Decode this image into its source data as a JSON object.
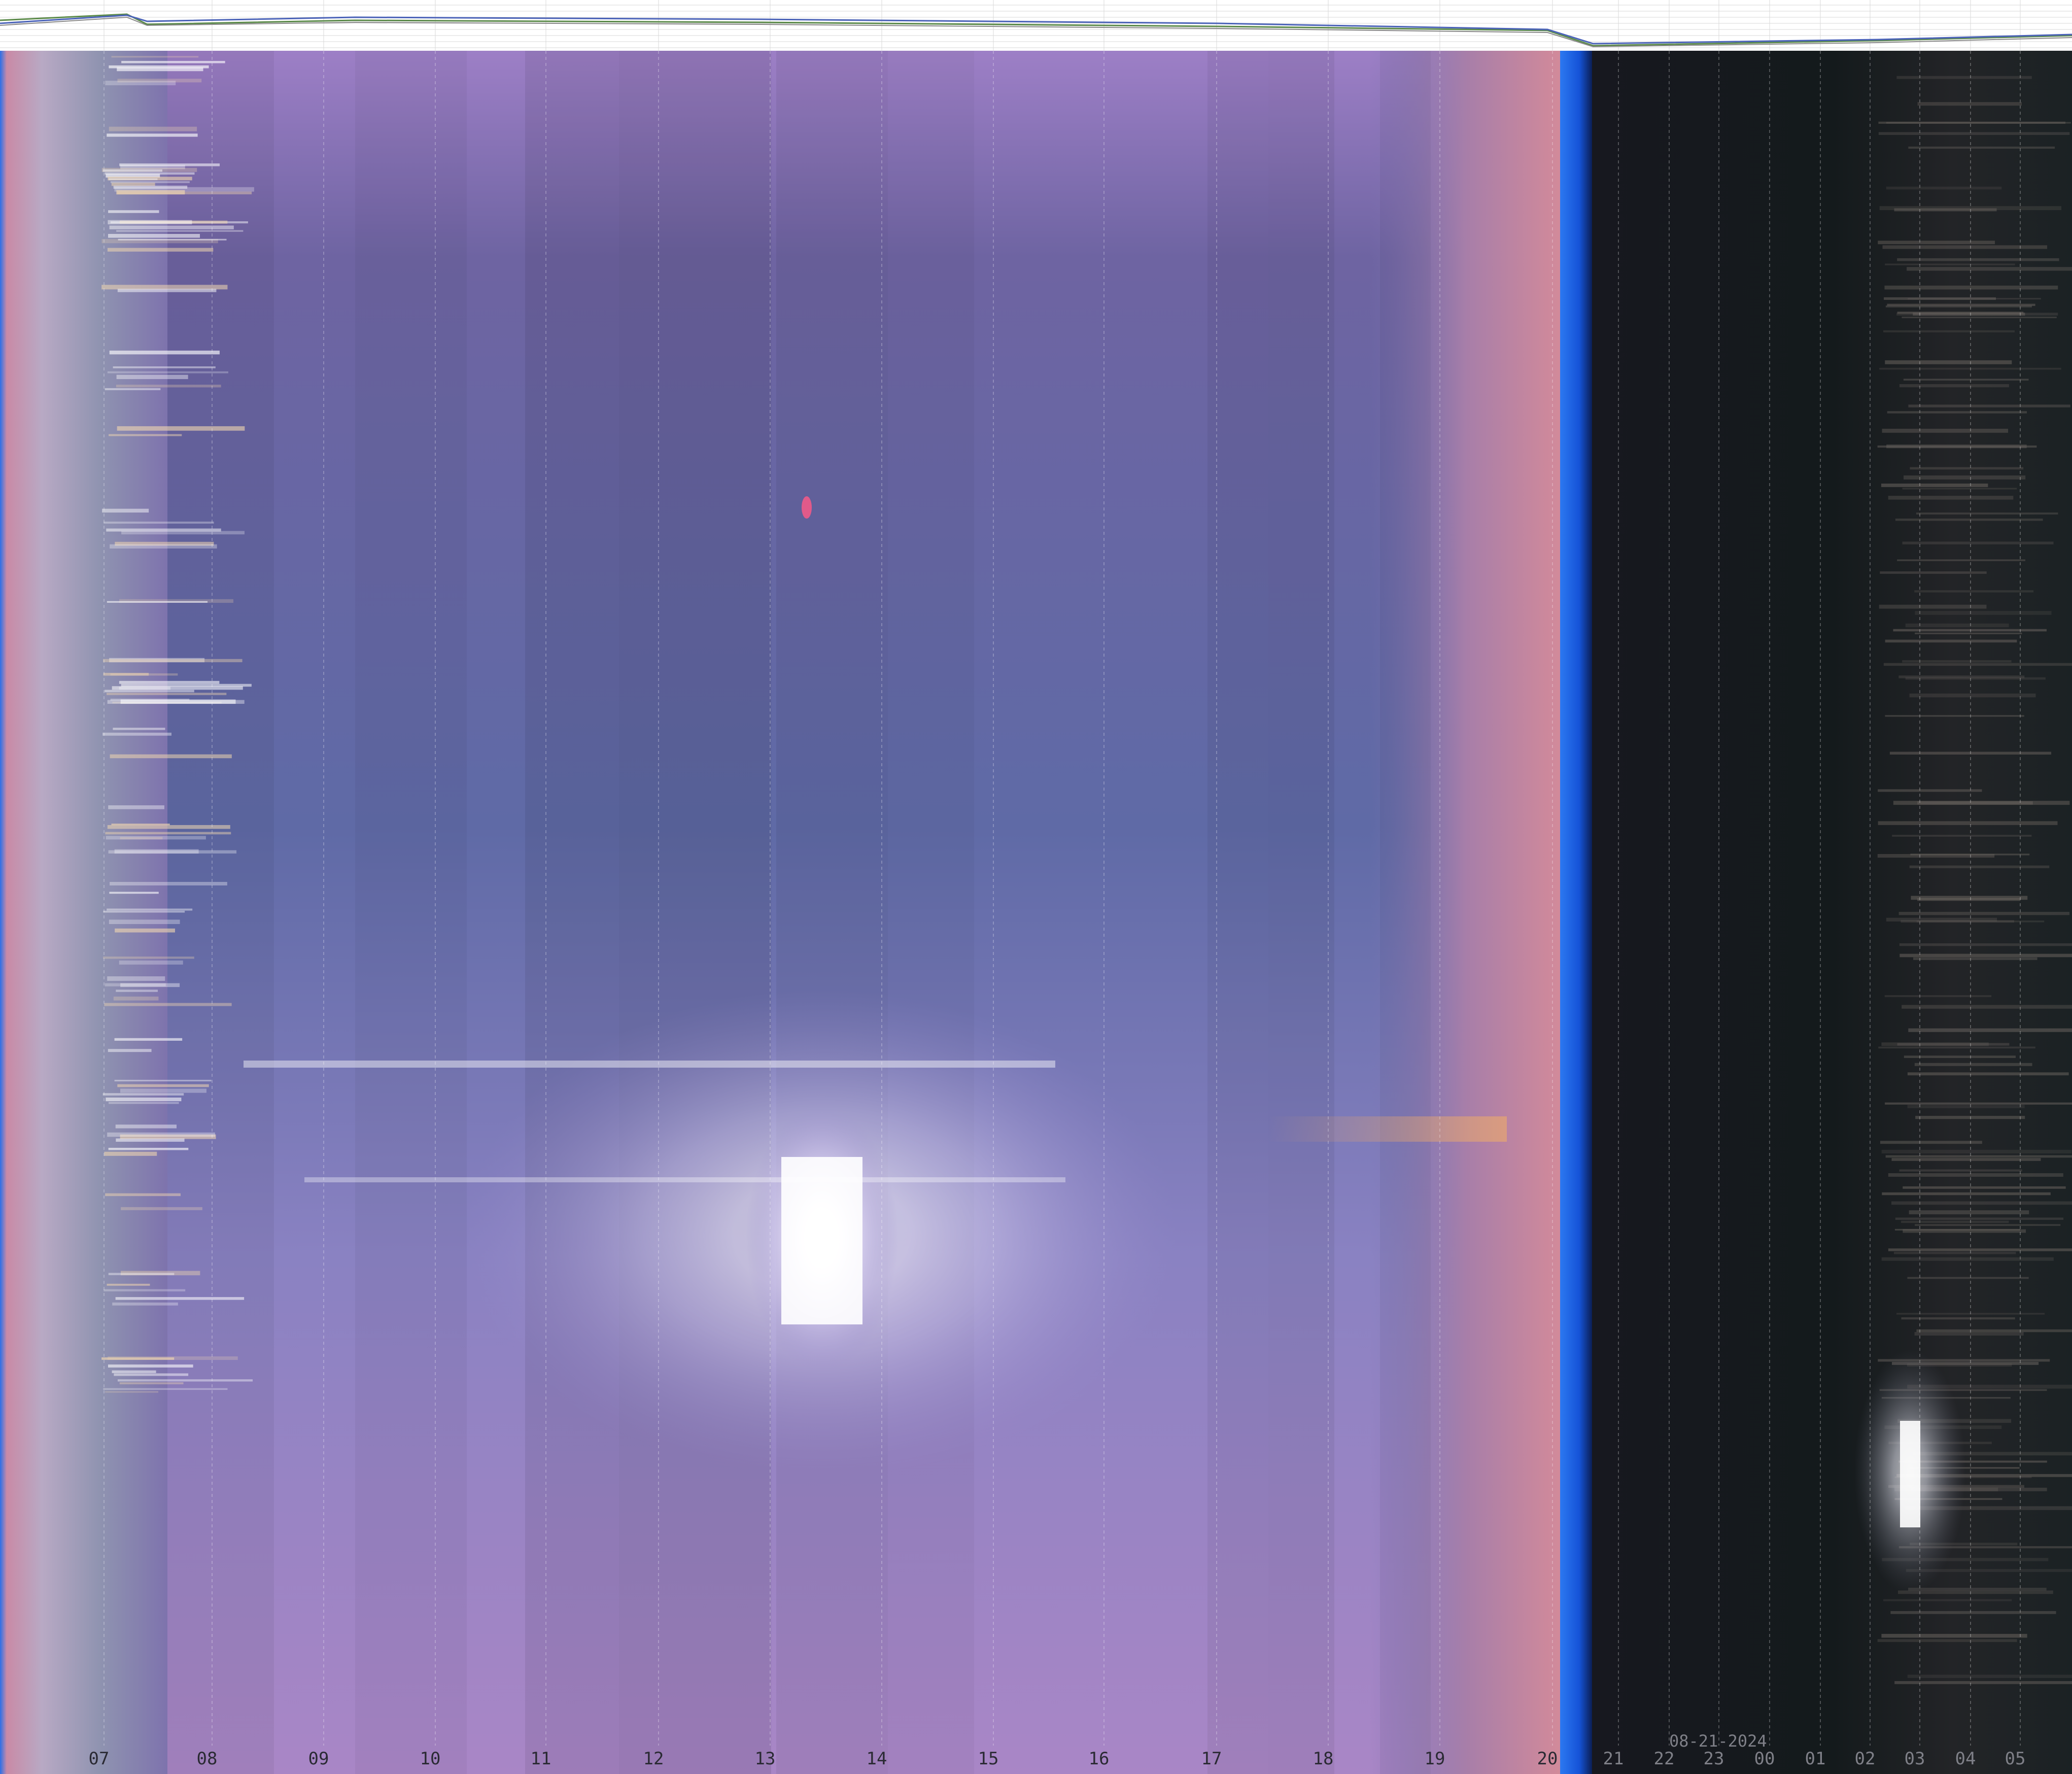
{
  "hour_labels": [
    "07",
    "08",
    "09",
    "10",
    "11",
    "12",
    "13",
    "14",
    "15",
    "16",
    "17",
    "18",
    "19",
    "20",
    "21",
    "22",
    "23",
    "00",
    "01",
    "02",
    "03",
    "04",
    "05"
  ],
  "date_label": "08-21-2024",
  "colors": {
    "day_purple": "#7f6fb0",
    "dusk_pink": "#c98aa6",
    "twilight_blue": "#1f63e6",
    "night_dark": "#171a1f",
    "graph_background": "#ffffff",
    "label_dark": "#2a2a33",
    "label_light": "#7f8088"
  }
}
